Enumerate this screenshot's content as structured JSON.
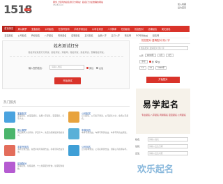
{
  "logo": {
    "number": "1518",
    "com": ".com"
  },
  "top_ad": {
    "line1": "服务上佳周的起名测打分网站！起名打分最准确的网站",
    "line2": "1518.com"
  },
  "top_right": {
    "item1": "加入收藏",
    "item2": "设为首页"
  },
  "nav": {
    "items": [
      "首页测名",
      "周公解梦",
      "宝宝起名",
      "公司起名",
      "在线号查询",
      "手机号测吉凶",
      "公司名测试",
      "八字算命",
      "在线起名",
      "姓名配对",
      "店铺起名",
      "英文起名"
    ]
  },
  "subnav": {
    "items": [
      "宝宝起名",
      "公司起名",
      "商标起名",
      "八字起名",
      "周易起名",
      "店铺起名",
      "五行起名",
      "生辰八字",
      "五行八字",
      "取名网",
      "QQ号测吉凶",
      "起名网"
    ]
  },
  "test": {
    "title": "姓名测试打分",
    "desc": "姓名测试免费打分测试，起名测试，测名网，姓名测试，姓名测试，查看姓名测试。",
    "name_label": "输入您的姓名：",
    "name_placeholder": "请输入姓名",
    "gender_male": "男性",
    "gender_female": "女性",
    "submit": "开始测试"
  },
  "hot": {
    "title": "热门服务",
    "services": [
      {
        "name": "宝宝起名",
        "desc": "宝宝起名，女宝宝起名，生辰八字起名，宝宝取名，名字大全。",
        "color": "#4aa3df"
      },
      {
        "name": "公司起名",
        "desc": "公司起名，公司名字测试，公司起名大全，免费公司起名。",
        "color": "#e8a33d"
      },
      {
        "name": "周公解梦",
        "desc": "周公解梦大全查询，梦见什么，免费为您解读梦境的含义。",
        "color": "#4bb56c"
      },
      {
        "name": "车牌测吉",
        "desc": "车牌号测吉凶，车牌号码测吉凶，车牌号码吉凶测试。",
        "color": "#59b0d8"
      },
      {
        "name": "手机号测吉",
        "desc": "手机号测吉凶，免费手机号码测吉凶，手机号码吉凶查询。",
        "color": "#e36d5b"
      },
      {
        "name": "公司测名",
        "desc": "公司名称测试，公司名称测吉凶，测算公司名称好坏。",
        "color": "#3f9fd6"
      },
      {
        "name": "星座配对",
        "desc": "星座配对，星座运势，十二星座配对查询，星座配对指数。",
        "color": "#b55bd1"
      }
    ]
  },
  "right": {
    "header": "姓名配对·爱情配对·测八字",
    "name_placeholder": "姓名配对·爱情配对·测八字",
    "row1": [
      "公历",
      "1990年",
      "1月",
      "1日"
    ],
    "row2": [
      "子时",
      "男",
      "女"
    ],
    "row3": [
      "11",
      "01",
      "1990年"
    ],
    "submit": "开始配对",
    "banner_title": "易学起名",
    "banner_sub": "专业起名·八字起名·周易取名·宝宝起名·公司起名",
    "form_labels": [
      "姓名：",
      "性别：",
      "出生："
    ],
    "form_placeholders": [
      "请输入姓名",
      "请输入出生日期",
      "请输入出生时辰"
    ],
    "brand": "欢乐起名"
  }
}
